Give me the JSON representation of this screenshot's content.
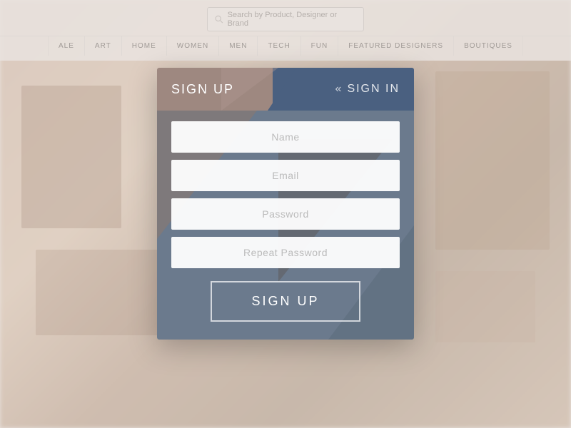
{
  "background": {
    "color": "#e8d5c8"
  },
  "navbar": {
    "search_placeholder": "Search by Product, Designer or Brand",
    "nav_items": [
      {
        "label": "ALE"
      },
      {
        "label": "ART"
      },
      {
        "label": "HOME"
      },
      {
        "label": "WOMEN"
      },
      {
        "label": "MEN"
      },
      {
        "label": "TECH"
      },
      {
        "label": "FUN"
      },
      {
        "label": "FEATURED DESIGNERS"
      },
      {
        "label": "BOUTIQUES"
      }
    ]
  },
  "modal": {
    "tab_signup": "SIGN UP",
    "tab_signin_chevron": "«",
    "tab_signin": "SIGN IN",
    "fields": [
      {
        "placeholder": "Name",
        "type": "text",
        "name": "name-input"
      },
      {
        "placeholder": "Email",
        "type": "email",
        "name": "email-input"
      },
      {
        "placeholder": "Password",
        "type": "password",
        "name": "password-input"
      },
      {
        "placeholder": "Repeat Password",
        "type": "password",
        "name": "repeat-password-input"
      }
    ],
    "submit_label": "SIGN UP"
  }
}
